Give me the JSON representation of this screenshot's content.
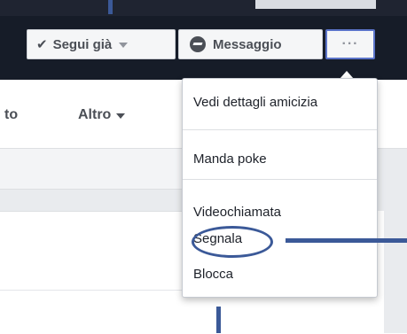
{
  "header": {
    "follow_button": {
      "label": "Segui già"
    },
    "message_button": {
      "label": "Messaggio"
    },
    "more_button": {
      "label": "···"
    }
  },
  "nav": {
    "items": [
      {
        "label": "to"
      },
      {
        "label": "Altro"
      }
    ]
  },
  "dropdown": {
    "items": [
      {
        "label": "Vedi dettagli amicizia"
      },
      {
        "label": "Manda poke"
      },
      {
        "label": "Videochiamata"
      },
      {
        "label": "Segnala"
      },
      {
        "label": "Blocca"
      }
    ]
  },
  "colors": {
    "annotation": "#3b5998",
    "cover": "#161c28",
    "button_bg": "#f5f6f7"
  }
}
